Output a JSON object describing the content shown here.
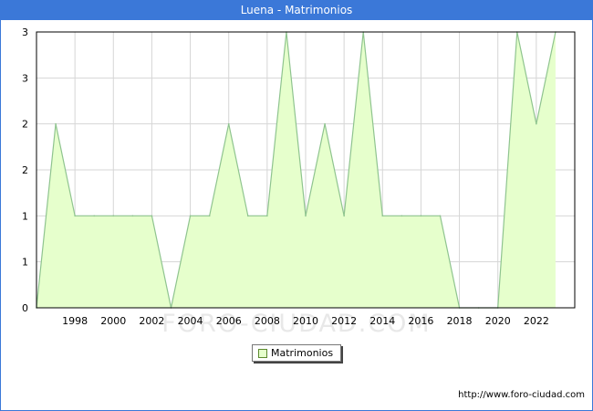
{
  "title": "Luena - Matrimonios",
  "source": "http://www.foro-ciudad.com",
  "watermark": "FORO-CIUDAD.COM",
  "colors": {
    "header": "#3b78d8",
    "area_fill": "#e6ffcc",
    "line": "#8fc48f",
    "grid": "#d6d6d6"
  },
  "chart_data": {
    "type": "area",
    "title": "Luena - Matrimonios",
    "xlabel": "",
    "ylabel": "",
    "x": [
      1996,
      1997,
      1998,
      1999,
      2000,
      2001,
      2002,
      2003,
      2004,
      2005,
      2006,
      2007,
      2008,
      2009,
      2010,
      2011,
      2012,
      2013,
      2014,
      2015,
      2016,
      2017,
      2018,
      2019,
      2020,
      2021,
      2022,
      2023
    ],
    "series": [
      {
        "name": "Matrimonios",
        "values": [
          0,
          2,
          1,
          1,
          1,
          1,
          1,
          0,
          1,
          1,
          2,
          1,
          1,
          3,
          1,
          2,
          1,
          3,
          1,
          1,
          1,
          1,
          0,
          0,
          0,
          3,
          2,
          3
        ]
      }
    ],
    "xlim": [
      1996,
      2024
    ],
    "ylim": [
      0,
      3
    ],
    "x_ticks": [
      "1998",
      "2000",
      "2002",
      "2004",
      "2006",
      "2008",
      "2010",
      "2012",
      "2014",
      "2016",
      "2018",
      "2020",
      "2022"
    ],
    "y_tick_labels": [
      "0",
      "1",
      "1",
      "2",
      "2",
      "3",
      "3"
    ],
    "grid": true,
    "legend": {
      "position": "bottom-center",
      "entries": [
        "Matrimonios"
      ]
    }
  }
}
